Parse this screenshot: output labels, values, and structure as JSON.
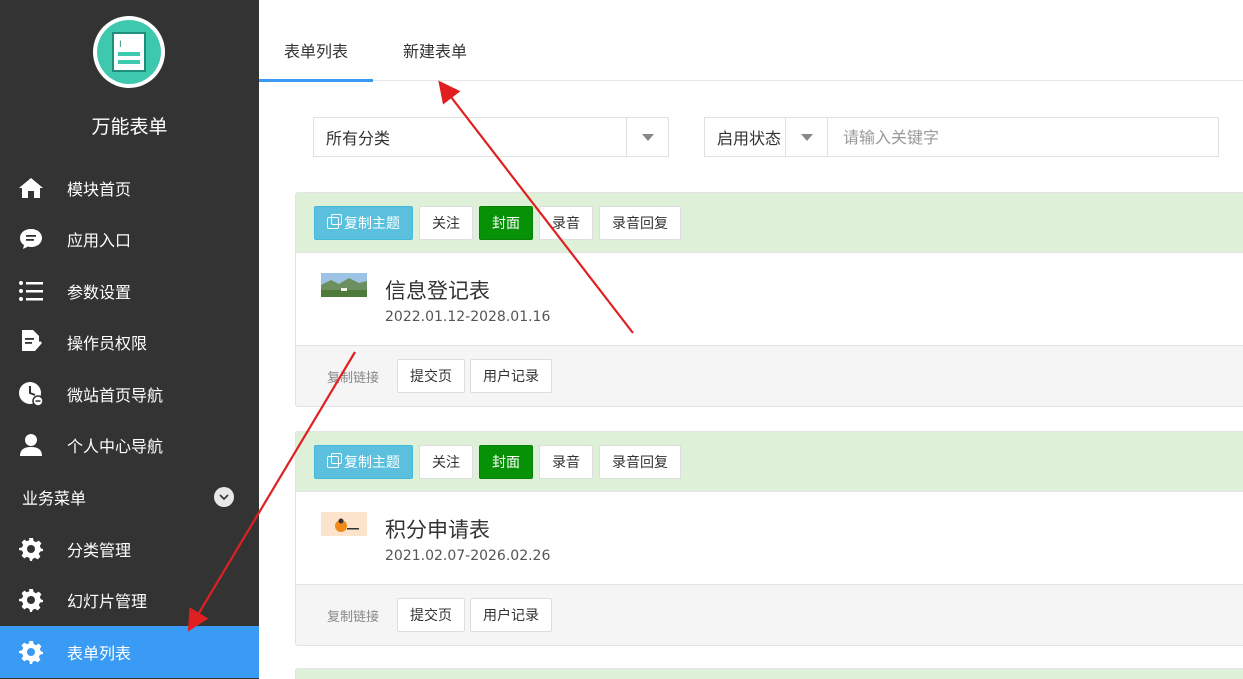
{
  "sidebar": {
    "app_title": "万能表单",
    "items": [
      {
        "label": "模块首页",
        "icon": "home-icon"
      },
      {
        "label": "应用入口",
        "icon": "chat-bubble-icon"
      },
      {
        "label": "参数设置",
        "icon": "list-icon"
      },
      {
        "label": "操作员权限",
        "icon": "edit-document-icon"
      },
      {
        "label": "微站首页导航",
        "icon": "clock-icon"
      },
      {
        "label": "个人中心导航",
        "icon": "user-icon"
      }
    ],
    "group_label": "业务菜单",
    "sub_items": [
      {
        "label": "分类管理",
        "icon": "gear-icon"
      },
      {
        "label": "幻灯片管理",
        "icon": "gear-icon"
      },
      {
        "label": "表单列表",
        "icon": "gear-icon",
        "active": true
      }
    ]
  },
  "tabs": [
    {
      "label": "表单列表",
      "active": true
    },
    {
      "label": "新建表单",
      "active": false
    }
  ],
  "filters": {
    "category_value": "所有分类",
    "status_value": "启用状态",
    "search_placeholder": "请输入关键字"
  },
  "card_actions": {
    "copy_theme": "复制主题",
    "follow": "关注",
    "cover": "封面",
    "record": "录音",
    "record_reply": "录音回复",
    "copy_link": "复制链接",
    "submit_page": "提交页",
    "user_records": "用户记录"
  },
  "forms": [
    {
      "title": "信息登记表",
      "date_range": "2022.01.12-2028.01.16",
      "thumb": "landscape-thumbnail"
    },
    {
      "title": "积分申请表",
      "date_range": "2021.02.07-2026.02.26",
      "thumb": "cartoon-thumbnail"
    }
  ],
  "colors": {
    "sidebar_bg": "#333333",
    "accent": "#3a9bf4",
    "card_header_bg": "#dff0d8",
    "btn_info": "#5bc0de",
    "btn_success": "#079107",
    "annotation_arrow": "#e02020"
  }
}
